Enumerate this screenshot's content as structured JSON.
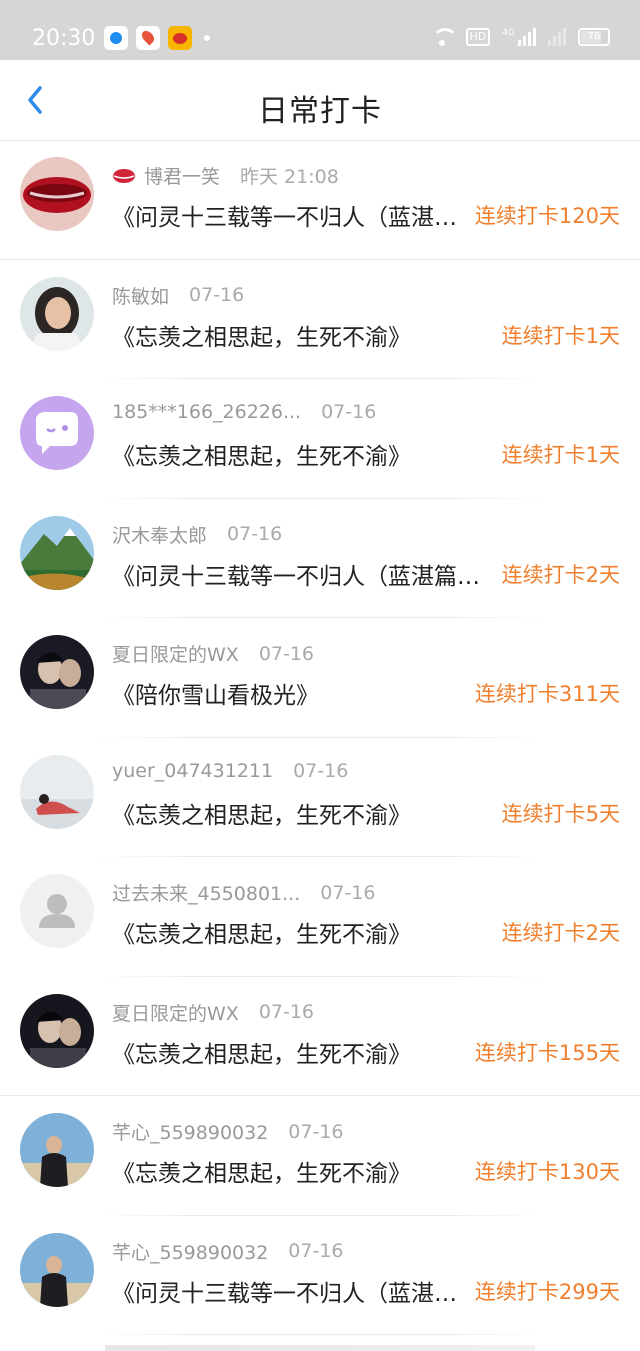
{
  "status_bar": {
    "time": "20:30",
    "network": "4G",
    "battery": "76"
  },
  "header": {
    "title": "日常打卡"
  },
  "entries": [
    {
      "user": "博君一笑",
      "date": "昨天 21:08",
      "book": "《问灵十三载等一不归人（蓝湛…",
      "streak": "连续打卡120天"
    },
    {
      "user": "陈敏如",
      "date": "07-16",
      "book": "《忘羡之相思起，生死不渝》",
      "streak": "连续打卡1天"
    },
    {
      "user": "185***166_26226...",
      "date": "07-16",
      "book": "《忘羡之相思起，生死不渝》",
      "streak": "连续打卡1天"
    },
    {
      "user": "沢木奉太郎",
      "date": "07-16",
      "book": "《问灵十三载等一不归人（蓝湛篇…",
      "streak": "连续打卡2天"
    },
    {
      "user": "夏日限定的WX",
      "date": "07-16",
      "book": "《陪你雪山看极光》",
      "streak": "连续打卡311天"
    },
    {
      "user": "yuer_047431211",
      "date": "07-16",
      "book": "《忘羡之相思起，生死不渝》",
      "streak": "连续打卡5天"
    },
    {
      "user": "过去未来_4550801...",
      "date": "07-16",
      "book": "《忘羡之相思起，生死不渝》",
      "streak": "连续打卡2天"
    },
    {
      "user": "夏日限定的WX",
      "date": "07-16",
      "book": "《忘羡之相思起，生死不渝》",
      "streak": "连续打卡155天"
    },
    {
      "user": "芊心_559890032",
      "date": "07-16",
      "book": "《忘羡之相思起，生死不渝》",
      "streak": "连续打卡130天"
    },
    {
      "user": "芊心_559890032",
      "date": "07-16",
      "book": "《问灵十三载等一不归人（蓝湛…",
      "streak": "连续打卡299天"
    }
  ],
  "colors": {
    "accent": "#f07f2e",
    "back": "#2d8cf0"
  }
}
